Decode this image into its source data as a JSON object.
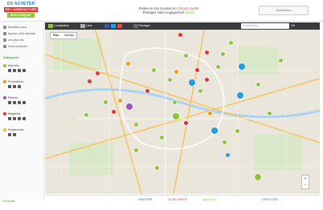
{
  "header": {
    "logo": {
      "line1": "OU ACHETER",
      "line2": "DE L'AGRICULTURE",
      "line3": "BIOLOGIQUE"
    },
    "tagline_line1_pre": "Faites-en vos courses en ",
    "tagline_line1_hl": "Circuits courts",
    "tagline_line2_pre": "Partagez votre engagement ",
    "tagline_line2_hl": "du Bio",
    "login_label": "Connexion"
  },
  "sidebar": {
    "links": [
      "Identifiez-vous",
      "Ajouter votre adresse",
      "Les pros bio",
      "Nous contacter"
    ],
    "section_title": "Catégories",
    "categories": [
      {
        "label": "Marchés",
        "color": "#8dc63f"
      },
      {
        "label": "Producteurs",
        "color": "#f39c12"
      },
      {
        "label": "Paniers",
        "color": "#9b59b6"
      },
      {
        "label": "Magasins",
        "color": "#e8312f"
      },
      {
        "label": "Restaurants",
        "color": "#f1c40f"
      }
    ],
    "lang_label": "Français"
  },
  "map": {
    "toolbar": [
      "Localisation",
      "Liste",
      "Partager"
    ],
    "search_placeholder": "Rechercher",
    "search_button": "OK",
    "map_types": [
      "Plan",
      "Satellite"
    ],
    "zoom_in": "+",
    "zoom_out": "−",
    "markers": [
      {
        "color": "#e8312f"
      },
      {
        "color": "#8dc63f"
      },
      {
        "color": "#8dc63f"
      },
      {
        "color": "#8dc63f"
      },
      {
        "color": "#e8312f"
      },
      {
        "color": "#f39c12"
      },
      {
        "color": "#2a9ad8"
      },
      {
        "color": "#8dc63f"
      },
      {
        "color": "#e8312f"
      },
      {
        "color": "#8dc63f"
      },
      {
        "color": "#f39c12"
      },
      {
        "color": "#e8312f"
      },
      {
        "color": "#8dc63f"
      },
      {
        "color": "#2a9ad8"
      },
      {
        "color": "#8dc63f"
      },
      {
        "color": "#e8312f"
      },
      {
        "color": "#8dc63f"
      },
      {
        "color": "#9b59b6"
      },
      {
        "color": "#f39c12"
      },
      {
        "color": "#8dc63f"
      },
      {
        "color": "#e8312f"
      },
      {
        "color": "#8dc63f"
      },
      {
        "color": "#2a9ad8"
      },
      {
        "color": "#8dc63f"
      },
      {
        "color": "#e8312f"
      },
      {
        "color": "#8dc63f"
      },
      {
        "color": "#8dc63f"
      },
      {
        "color": "#f39c12"
      },
      {
        "color": "#8dc63f"
      },
      {
        "color": "#e8312f"
      },
      {
        "color": "#8dc63f"
      },
      {
        "color": "#2a9ad8"
      },
      {
        "color": "#8dc63f"
      },
      {
        "color": "#8dc63f"
      },
      {
        "color": "#e8312f"
      },
      {
        "color": "#8dc63f"
      },
      {
        "color": "#2a9ad8"
      },
      {
        "color": "#8dc63f"
      },
      {
        "color": "#8dc63f"
      },
      {
        "color": "#8dc63f"
      }
    ]
  },
  "footer": {
    "partners": [
      "MINISTÈRE",
      "ILE DE FRANCE",
      "Agence BIO",
      "CARTOCOPE"
    ]
  }
}
